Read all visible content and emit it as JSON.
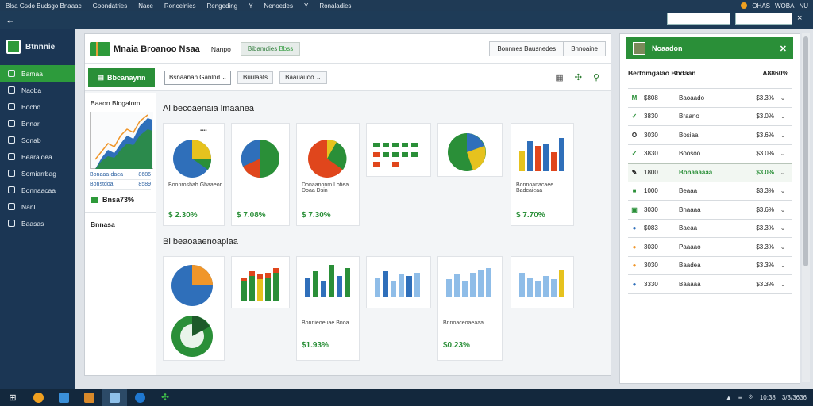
{
  "menubar": {
    "items": [
      "Blsa Gsdo Budsgo Bnaaac",
      "Goondatries",
      "Nace",
      "Roncelnies",
      "Rengeding",
      "Y",
      "Nenoedes",
      "Y",
      "Ronaladies"
    ],
    "right": [
      "OHAS",
      "WOBA",
      "NU"
    ]
  },
  "topstrip": {
    "back_icon": "←",
    "search1": "",
    "search2": "",
    "close_icon": "×"
  },
  "sidebar": {
    "logo": "Btnnnie",
    "items": [
      {
        "label": "Bamaa",
        "active": true
      },
      {
        "label": "Naoba",
        "active": false
      },
      {
        "label": "Bocho",
        "active": false
      },
      {
        "label": "Bnnar",
        "active": false
      },
      {
        "label": "Sonab",
        "active": false
      },
      {
        "label": "Bearaidea",
        "active": false
      },
      {
        "label": "Somiarrbag",
        "active": false
      },
      {
        "label": "Bonnaacaa",
        "active": false
      },
      {
        "label": "Nanl",
        "active": false
      },
      {
        "label": "Baasas",
        "active": false
      }
    ]
  },
  "main": {
    "brand": "Mnaia Broanoo Nsaa",
    "link": "Nanpo",
    "pill": "Bibamdies",
    "pill_value": "Bbss",
    "seg": [
      "Bonnnes Bausnedes",
      "Bnnoaine"
    ],
    "toolbar": {
      "button": "Bbcanaynn",
      "select": "Bsnaanah Ganlnd",
      "button2": "Buulaats",
      "button3": "Baauaudo"
    },
    "left": {
      "title": "Baaon Blogalom",
      "rows": [
        [
          "Bonaaa-daea",
          "8686"
        ],
        [
          "Bonstdoa",
          "8589"
        ]
      ],
      "stat": "Bnsa73%",
      "footer": "Bnnasa"
    },
    "section1": "Al becoaenaia lmaanea",
    "section2": "Bl beaoaaenoapiaa",
    "cards_top": [
      {
        "label": "Boonroshah Ghaaeor",
        "value": "$ 2.30%"
      },
      {
        "label": "",
        "value": "$ 7.08%"
      },
      {
        "label": "Donaanonm Lotiea Doaa Dsin",
        "value": "$ 7.30%"
      },
      {
        "label": "",
        "value": ""
      },
      {
        "label": "",
        "value": ""
      },
      {
        "label": "Bonnoanacaee Badcaieaa",
        "value": "$ 7.70%"
      }
    ],
    "cards_bottom": [
      {
        "label": "",
        "value": ""
      },
      {
        "label": "",
        "value": ""
      },
      {
        "label": "Bonnieoeuae Bnoa",
        "value": "$1.93%"
      },
      {
        "label": "",
        "value": ""
      },
      {
        "label": "Bnnoaceoaeaaa",
        "value": "$0.23%"
      },
      {
        "label": "",
        "value": ""
      }
    ]
  },
  "right": {
    "header": "Noaadon",
    "summary_label": "Bertomgalao Bbdaan",
    "summary_value": "A8860%",
    "rows": [
      {
        "icon": "M",
        "code": "$808",
        "name": "Baoaado",
        "value": "$3.3%",
        "hl": false
      },
      {
        "icon": "✓",
        "code": "3830",
        "name": "Braano",
        "value": "$3.0%",
        "hl": false
      },
      {
        "icon": "O",
        "code": "3030",
        "name": "Bosiaa",
        "value": "$3.6%",
        "hl": false
      },
      {
        "icon": "✓",
        "code": "3830",
        "name": "Boosoo",
        "value": "$3.0%",
        "hl": false
      },
      {
        "icon": "✎",
        "code": "1800",
        "name": "Bonaaaaaa",
        "value": "$3.0%",
        "hl": true
      },
      {
        "icon": "■",
        "code": "1000",
        "name": "Beaaa",
        "value": "$3.3%",
        "hl": false
      },
      {
        "icon": "▣",
        "code": "3030",
        "name": "Bnaaaa",
        "value": "$3.6%",
        "hl": false
      },
      {
        "icon": "●",
        "code": "$083",
        "name": "Baeaa",
        "value": "$3.3%",
        "hl": false
      },
      {
        "icon": "●",
        "code": "3030",
        "name": "Paaaao",
        "value": "$3.3%",
        "hl": false
      },
      {
        "icon": "●",
        "code": "3030",
        "name": "Baadea",
        "value": "$3.3%",
        "hl": false
      },
      {
        "icon": "●",
        "code": "3330",
        "name": "Baaaaa",
        "value": "$3.3%",
        "hl": false
      }
    ]
  },
  "taskbar": {
    "tray": [
      "▲",
      "≡",
      "⟐",
      "10:38",
      "3/3/3636"
    ]
  },
  "colors": {
    "accent": "#2a8f38",
    "sidebar": "#1b3654",
    "blue": "#2f6fba",
    "yellow": "#e6c21e",
    "red": "#e0461c",
    "orange": "#f0962a"
  }
}
